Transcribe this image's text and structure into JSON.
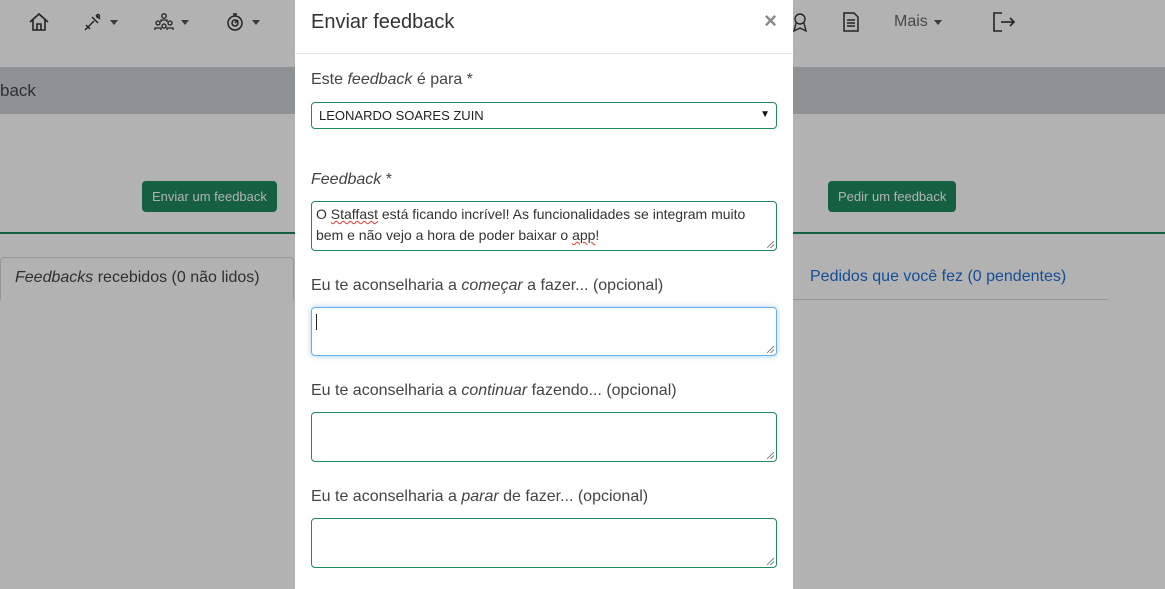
{
  "nav": {
    "icons": [
      "home-icon",
      "tools-icon",
      "team-icon",
      "stopwatch-icon",
      "badge-icon",
      "document-icon",
      "logout-icon"
    ],
    "more_label": "Mais"
  },
  "subheader": {
    "title": "back"
  },
  "actions": {
    "send_feedback": "Enviar um feedback",
    "ask_feedback": "Pedir um feedback"
  },
  "tabs": {
    "received_italic": "Feedbacks",
    "received_rest": " recebidos (0 não lidos)",
    "requests": "Pedidos que você fez (0 pendentes)"
  },
  "modal": {
    "title": "Enviar feedback",
    "close": "×",
    "recipient": {
      "label_pre": "Este ",
      "label_italic": "feedback",
      "label_post": " é para *",
      "value": "LEONARDO SOARES ZUIN",
      "arrow": "▼"
    },
    "feedback": {
      "label_italic": "Feedback",
      "label_post": " *",
      "text_pre": "O ",
      "text_spell1": "Staffast",
      "text_mid": " está ficando incrível! As funcionalidades se integram muito bem e não vejo a hora de poder baixar o ",
      "text_spell2": "app",
      "text_post": "!"
    },
    "start": {
      "label_pre": "Eu te aconselharia a ",
      "label_italic": "começar",
      "label_post": " a fazer... (opcional)",
      "value": ""
    },
    "continue": {
      "label_pre": "Eu te aconselharia a ",
      "label_italic": "continuar",
      "label_post": " fazendo... (opcional)",
      "value": ""
    },
    "stop": {
      "label_pre": "Eu te aconselharia a ",
      "label_italic": "parar",
      "label_post": " de fazer... (opcional)",
      "value": ""
    }
  },
  "colors": {
    "brand_green": "#1e8a5e",
    "link_blue": "#1e6fd9",
    "focus_blue": "#66afe9",
    "overlay": "rgba(0,0,0,0.30)"
  }
}
